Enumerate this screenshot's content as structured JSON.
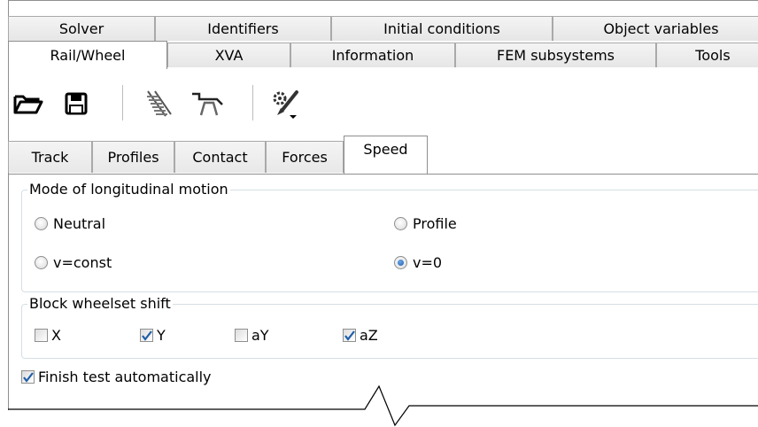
{
  "tabs_row1": [
    "Solver",
    "Identifiers",
    "Initial conditions",
    "Object variables"
  ],
  "tabs_row2": [
    "Rail/Wheel",
    "XVA",
    "Information",
    "FEM subsystems",
    "Tools"
  ],
  "active_tab": "Rail/Wheel",
  "toolbar": {
    "icons": [
      "open-folder-icon",
      "save-icon",
      "track-icon",
      "wheel-profile-icon",
      "settings-wrench-icon"
    ]
  },
  "subtabs": [
    "Track",
    "Profiles",
    "Contact",
    "Forces",
    "Speed"
  ],
  "active_subtab": "Speed",
  "longitudinal": {
    "title": "Mode of longitudinal motion",
    "options": [
      "Neutral",
      "Profile",
      "v=const",
      "v=0"
    ],
    "selected": "v=0"
  },
  "wheelset_shift": {
    "title": "Block wheelset shift",
    "items": [
      {
        "label": "X",
        "checked": false
      },
      {
        "label": "Y",
        "checked": true
      },
      {
        "label": "aY",
        "checked": false
      },
      {
        "label": "aZ",
        "checked": true
      }
    ]
  },
  "finish_test": {
    "label": "Finish test automatically",
    "checked": true
  },
  "colors": {
    "accent": "#1f5ea8",
    "border": "#8e8f8f",
    "group_border": "#d5dfe5"
  }
}
